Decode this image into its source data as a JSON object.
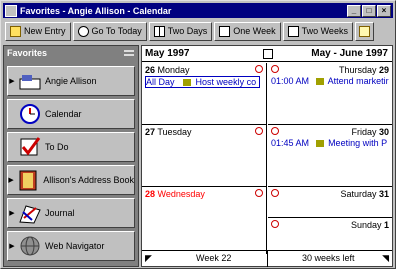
{
  "window": {
    "title": "Favorites - Angie Allison - Calendar"
  },
  "toolbar": {
    "new_entry": "New Entry",
    "go_to_today": "Go To Today",
    "two_days": "Two Days",
    "one_week": "One Week",
    "two_weeks": "Two Weeks"
  },
  "favorites": {
    "header": "Favorites",
    "items": [
      {
        "label": "Angie Allison",
        "icon": "person-card-icon",
        "has_arrow": true
      },
      {
        "label": "Calendar",
        "icon": "clock-icon",
        "has_arrow": false
      },
      {
        "label": "To Do",
        "icon": "checkmark-icon",
        "has_arrow": false
      },
      {
        "label": "Allison's Address Book",
        "icon": "book-icon",
        "has_arrow": true
      },
      {
        "label": "Journal",
        "icon": "journal-icon",
        "has_arrow": true
      },
      {
        "label": "Web Navigator",
        "icon": "globe-icon",
        "has_arrow": true
      }
    ]
  },
  "calendar": {
    "left_month": "May 1997",
    "right_month": "May - June 1997",
    "days": [
      {
        "num": "26",
        "name": "Monday",
        "events": [
          {
            "time": "All Day",
            "text": "Host weekly co"
          }
        ]
      },
      {
        "num": "27",
        "name": "Tuesday",
        "events": []
      },
      {
        "num": "28",
        "name": "Wednesday",
        "events": []
      },
      {
        "num": "29",
        "name": "Thursday",
        "events": [
          {
            "time": "01:00 AM",
            "text": "Attend marketir"
          }
        ]
      },
      {
        "num": "30",
        "name": "Friday",
        "events": [
          {
            "time": "01:45 AM",
            "text": "Meeting with P"
          }
        ]
      },
      {
        "num": "31",
        "name": "Saturday",
        "events": []
      },
      {
        "num": "1",
        "name": "Sunday",
        "events": []
      }
    ],
    "footer_left": "Week 22",
    "footer_right": "30 weeks left"
  },
  "colors": {
    "title_bar": "#000080",
    "event_text": "#0000c0",
    "today_red": "#ff0000"
  }
}
